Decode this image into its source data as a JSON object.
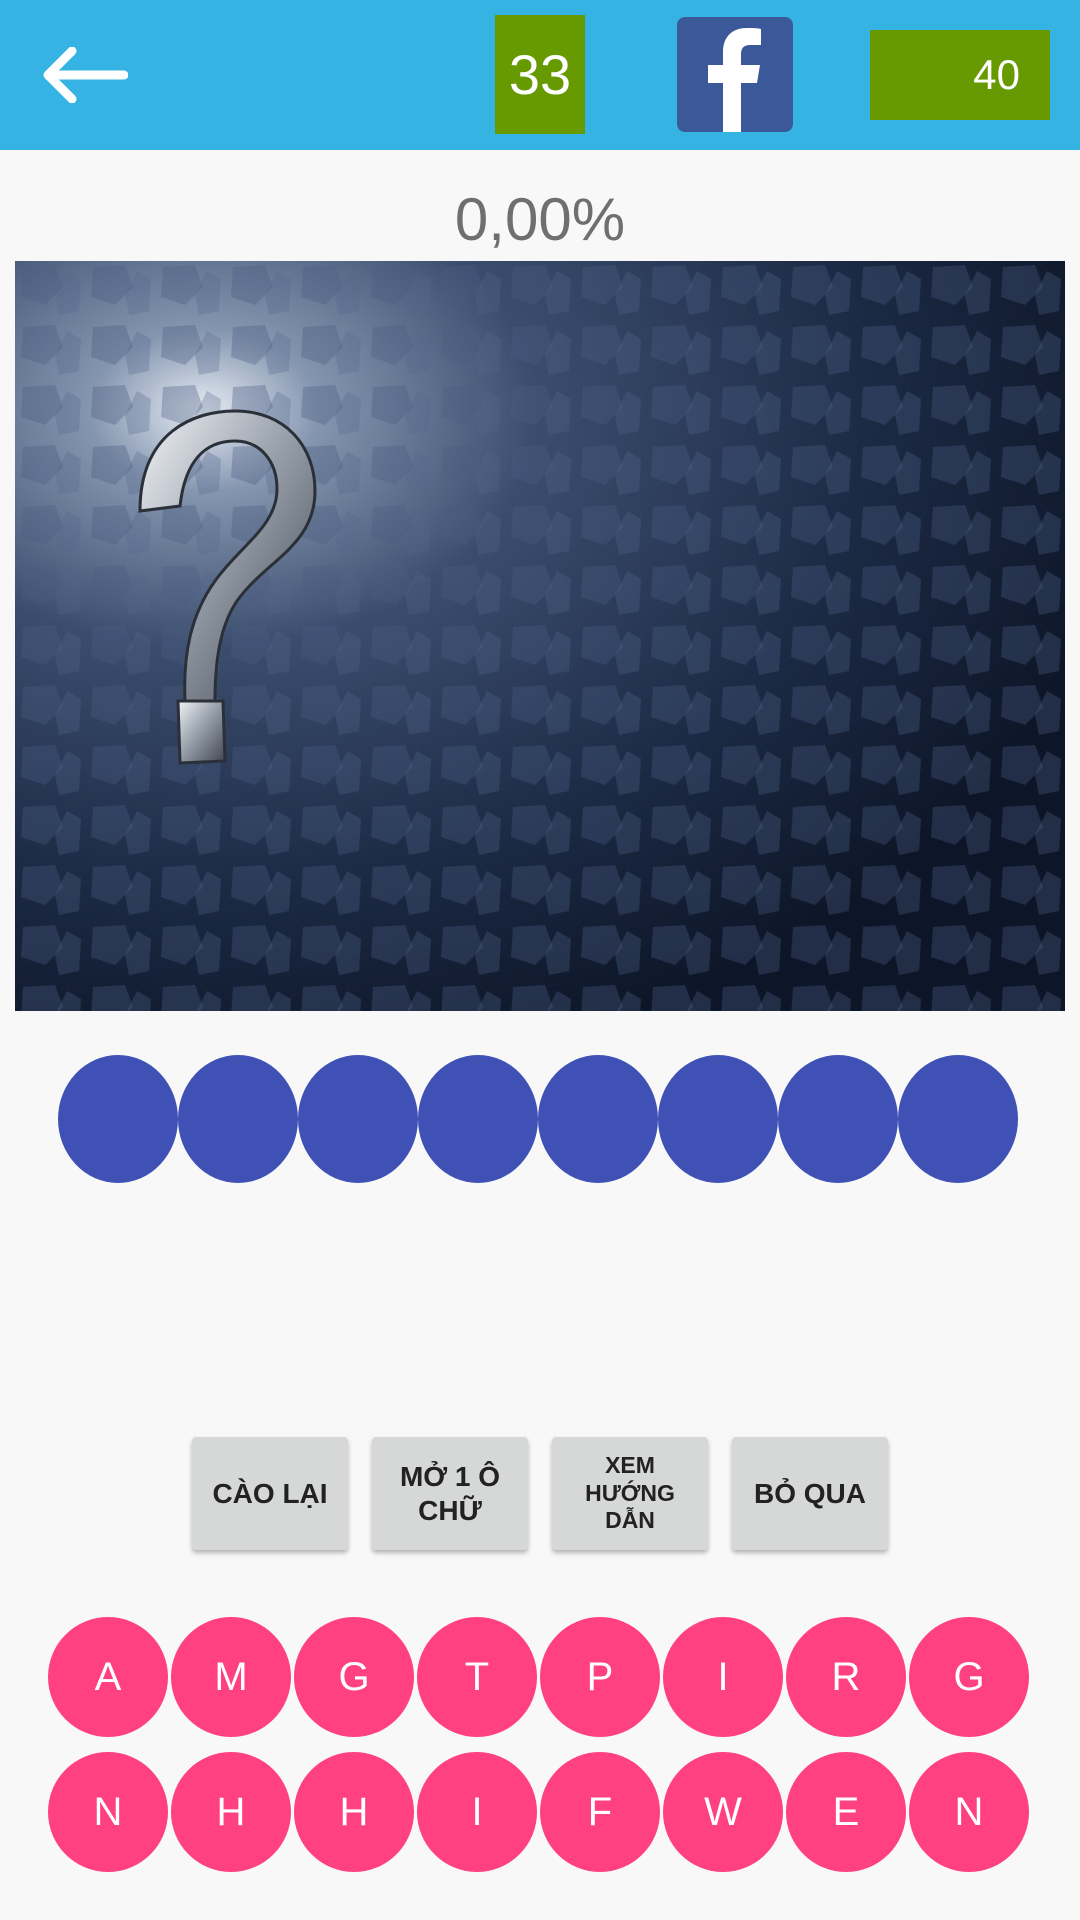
{
  "header": {
    "back_icon": "arrow-left-icon",
    "level": "33",
    "share_icon": "facebook-icon",
    "coins": "40"
  },
  "progress": "0,00%",
  "puzzle": {
    "image": "question-mark-image",
    "answer_slots": 8
  },
  "actions": [
    {
      "label": "CÀO LẠI"
    },
    {
      "label": "MỞ 1 Ô CHỮ"
    },
    {
      "label": "XEM HƯỚNG DẪN"
    },
    {
      "label": "BỎ QUA"
    }
  ],
  "letters_row1": [
    "A",
    "M",
    "G",
    "T",
    "P",
    "I",
    "R",
    "G"
  ],
  "letters_row2": [
    "N",
    "H",
    "H",
    "I",
    "F",
    "W",
    "E",
    "N"
  ],
  "colors": {
    "topbar": "#35b4e4",
    "green": "#669a00",
    "facebook": "#3b5998",
    "slot": "#3f51b5",
    "letter": "#ff4081"
  }
}
